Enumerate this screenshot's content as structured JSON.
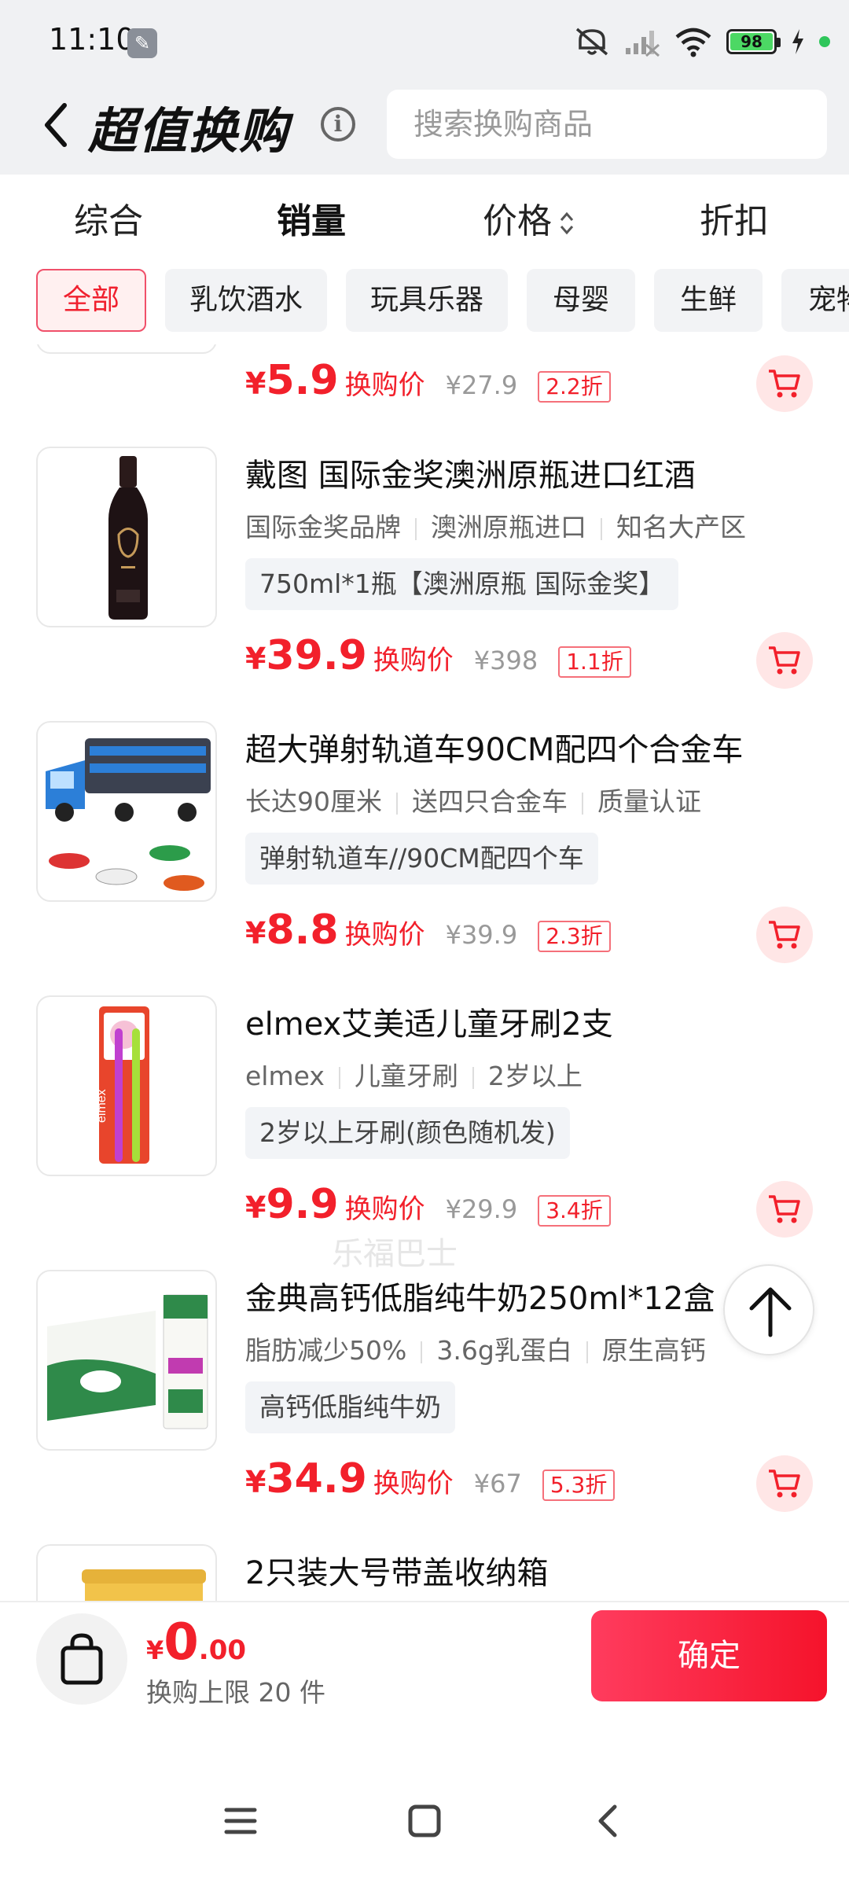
{
  "status_bar": {
    "time": "11:10",
    "battery": "98",
    "battery_level": 0.98
  },
  "header": {
    "title": "超值换购",
    "search_placeholder": "搜索换购商品"
  },
  "sort_tabs": [
    {
      "label": "综合"
    },
    {
      "label": "销量"
    },
    {
      "label": "价格"
    },
    {
      "label": "折扣"
    }
  ],
  "categories": [
    "全部",
    "乳饮酒水",
    "玩具乐器",
    "母婴",
    "生鲜",
    "宠物"
  ],
  "products": [
    {
      "title": "",
      "tags": [],
      "spec": "",
      "price": "5.9",
      "price_label": "换购价",
      "original": "¥27.9",
      "discount": "2.2折"
    },
    {
      "title": "戴图 国际金奖澳洲原瓶进口红酒",
      "tags": [
        "国际金奖品牌",
        "澳洲原瓶进口",
        "知名大产区"
      ],
      "spec": "750ml*1瓶【澳洲原瓶 国际金奖】",
      "price": "39.9",
      "price_label": "换购价",
      "original": "¥398",
      "discount": "1.1折"
    },
    {
      "title": "超大弹射轨道车90CM配四个合金车",
      "tags": [
        "长达90厘米",
        "送四只合金车",
        "质量认证"
      ],
      "spec": "弹射轨道车//90CM配四个车",
      "price": "8.8",
      "price_label": "换购价",
      "original": "¥39.9",
      "discount": "2.3折"
    },
    {
      "title": "elmex艾美适儿童牙刷2支",
      "tags": [
        "elmex",
        "儿童牙刷",
        "2岁以上"
      ],
      "spec": "2岁以上牙刷(颜色随机发)",
      "price": "9.9",
      "price_label": "换购价",
      "original": "¥29.9",
      "discount": "3.4折"
    },
    {
      "title": "金典高钙低脂纯牛奶250ml*12盒",
      "tags": [
        "脂肪减少50%",
        "3.6g乳蛋白",
        "原生高钙"
      ],
      "spec": "高钙低脂纯牛奶",
      "price": "34.9",
      "price_label": "换购价",
      "original": "¥67",
      "discount": "5.3折"
    },
    {
      "title": "2只装大号带盖收纳箱",
      "tags": [],
      "spec": "",
      "price": "",
      "price_label": "",
      "original": "",
      "discount": ""
    }
  ],
  "watermark": "乐福巴士",
  "footer": {
    "currency": "¥",
    "total_int": "0",
    "total_dec": ".00",
    "limit": "换购上限 20 件",
    "confirm": "确定"
  },
  "colors": {
    "accent": "#f2202b",
    "header_bg": "#f0f1f3",
    "cart_bg": "#ffe6e6"
  }
}
